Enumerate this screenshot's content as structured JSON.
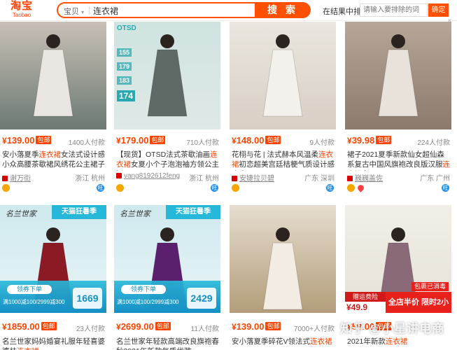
{
  "header": {
    "logo_cn": "淘宝",
    "logo_en": "Taobao",
    "search_type": "宝贝",
    "search_query": "连衣裙",
    "search_button": "搜 索",
    "filter_label": "在结果中排除",
    "filter_placeholder": "请输入要排除的词",
    "confirm_button": "确定",
    "close": "×"
  },
  "products_top": [
    {
      "currency": "¥",
      "price": "139.00",
      "tag": "包邮",
      "sales": "1400人付款",
      "title_pre": "安小落夏季",
      "title_hl": "连衣裙",
      "title_post": "女法式设计感小众高腰茶歇裙风绣花公主裙子",
      "shop": "谢万街",
      "location": "浙江 杭州",
      "img_colors": [
        "#c9c0b6",
        "#e9e6e1",
        "#6b7a73"
      ]
    },
    {
      "currency": "¥",
      "price": "179.00",
      "tag": "包邮",
      "sales": "710人付款",
      "title_pre": "【现货】OTSD法式茶歇油画",
      "title_hl": "连衣裙",
      "title_post": "女夏小个子泡泡袖方领公主裙子",
      "shop": "vang8192612feng",
      "location": "浙江 杭州",
      "img_colors": [
        "#cfe3e0",
        "#5f6a66",
        "#dfe9e7"
      ],
      "img_label": "OTSD",
      "img_sizes": [
        "155",
        "179",
        "183",
        "174"
      ]
    },
    {
      "currency": "¥",
      "price": "148.00",
      "tag": "包邮",
      "sales": "9人付款",
      "title_pre": "花栩与花 | 法式赫本风温柔",
      "title_hl": "连衣裙",
      "title_post": "初恋超美宫廷桔梗气质设计感小众",
      "shop": "安婕拉贝碧",
      "location": "广东 深圳",
      "img_colors": [
        "#eae6df",
        "#f4f1ec",
        "#d8cfc4"
      ]
    },
    {
      "currency": "¥",
      "price": "39.98",
      "tag": "包邮",
      "sales": "224人付款",
      "title_pre": "裙子2021夏季新款仙女超仙森系复古中国风旗袍改良版汉服",
      "title_hl": "连衣裙",
      "title_post": "女",
      "shop": "巍巍盖佐",
      "location": "广东 广州",
      "img_colors": [
        "#b6a79a",
        "#e8e2da",
        "#8c7a6c"
      ]
    }
  ],
  "products_bottom": [
    {
      "currency": "¥",
      "price": "1859.00",
      "tag": "包邮",
      "sales": "23人付款",
      "title_pre": "名兰世家妈妈婚宴礼服年轻喜婆婆装",
      "title_hl": "连衣裙",
      "title_post": "",
      "brand": "名兰世家",
      "tm_badge": "天猫狂暑季",
      "coupon_btn": "领券下单",
      "coupon_text": "满1000减100/2999减300",
      "big_num": "1669",
      "img_colors": [
        "#cfe9ee",
        "#8b1a24",
        "#e8f4f6"
      ]
    },
    {
      "currency": "¥",
      "price": "2699.00",
      "tag": "包邮",
      "sales": "11人付款",
      "title_pre": "名兰世家年轻款高端改良旗袍春秋2021年新款气质优雅",
      "title_hl": "",
      "title_post": "",
      "brand": "名兰世家",
      "tm_badge": "天猫狂暑季",
      "coupon_btn": "领券下单",
      "coupon_text": "满1000减100/2999减300",
      "big_num": "2429",
      "img_colors": [
        "#cfe9ee",
        "#5c1f6e",
        "#e8f4f6"
      ]
    },
    {
      "currency": "¥",
      "price": "139.00",
      "tag": "包邮",
      "sales": "7000+人付款",
      "title_pre": "安小落夏季碎花V领法式",
      "title_hl": "连衣裙",
      "title_post": "",
      "img_colors": [
        "#e6ddd0",
        "#f2ece2",
        "#b39d7a"
      ]
    },
    {
      "currency": "¥",
      "price": "59.00",
      "tag": "包邮",
      "sales": "",
      "title_pre": "2021年新款",
      "title_hl": "连衣裙",
      "title_post": "",
      "promo_tag": "赠运费险",
      "promo_price": "¥49.9",
      "promo_red": "全店半价 限时2小时",
      "promo_red_top": "包裹已消毒",
      "img_colors": [
        "#f1efe8",
        "#8a6a78",
        "#e6e1d8"
      ]
    }
  ],
  "watermark": "知乎 @小星讲电商"
}
